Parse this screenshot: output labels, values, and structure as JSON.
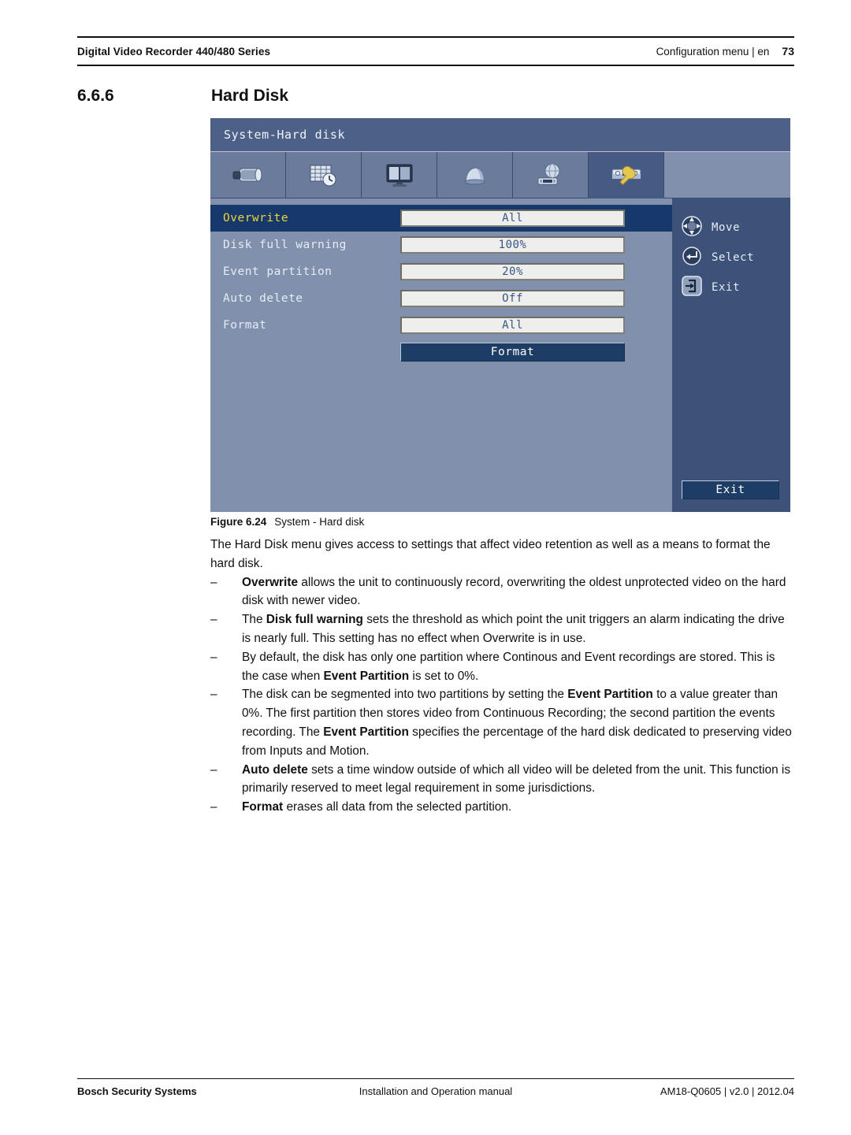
{
  "header": {
    "left_title": "Digital Video Recorder 440/480 Series",
    "right_title": "Configuration menu | en",
    "page_number": "73"
  },
  "section": {
    "number": "6.6.6",
    "title": "Hard Disk"
  },
  "screenshot": {
    "window_title": "System-Hard disk",
    "toolbar": {
      "tabs": [
        {
          "icon": "camera-icon",
          "name": "camera",
          "active": false
        },
        {
          "icon": "schedule-calendar-clock-icon",
          "name": "schedule",
          "active": false
        },
        {
          "icon": "display-monitor-icon",
          "name": "display",
          "active": false
        },
        {
          "icon": "alarm-siren-icon",
          "name": "event",
          "active": false
        },
        {
          "icon": "network-globe-icon",
          "name": "network",
          "active": false
        },
        {
          "icon": "wrench-system-icon",
          "name": "system",
          "active": true
        }
      ]
    },
    "settings": [
      {
        "label": "Overwrite",
        "value": "All",
        "selected": true
      },
      {
        "label": "Disk full warning",
        "value": "100%",
        "selected": false
      },
      {
        "label": "Event partition",
        "value": "20%",
        "selected": false
      },
      {
        "label": "Auto delete",
        "value": "Off",
        "selected": false
      },
      {
        "label": "Format",
        "value": "All",
        "selected": false
      }
    ],
    "format_button": "Format",
    "legend": [
      {
        "icon": "dpad-icon",
        "label": "Move"
      },
      {
        "icon": "enter-key-icon",
        "label": "Select"
      },
      {
        "icon": "exit-arrow-icon",
        "label": "Exit"
      }
    ],
    "exit_button": "Exit",
    "colors": {
      "panel_background": "#8190ac",
      "title_bar": "#4d6188",
      "selected_row": "#16386b",
      "selected_label_text": "#f2d43c",
      "value_field": "#eeeeec",
      "value_text": "#3a5384",
      "action_button": "#1d3d66",
      "sidebar": "#3d5279"
    }
  },
  "figure_caption": {
    "label": "Figure 6.24",
    "text": "System - Hard disk"
  },
  "body": {
    "intro": "The Hard Disk menu gives access to settings that affect video retention as well as a means to format the hard disk.",
    "bullet_marker": "–",
    "bullets": [
      [
        {
          "bold": true,
          "text": "Overwrite"
        },
        {
          "bold": false,
          "text": " allows the unit to continuously record, overwriting the oldest unprotected video on the hard disk with newer video."
        }
      ],
      [
        {
          "bold": false,
          "text": "The "
        },
        {
          "bold": true,
          "text": "Disk full warning"
        },
        {
          "bold": false,
          "text": " sets the threshold as which point the unit triggers an alarm indicating the drive is nearly full. This setting has no effect when Overwrite is in use."
        }
      ],
      [
        {
          "bold": false,
          "text": "By default, the disk has only one partition where Continous and Event recordings are stored. This is the case when "
        },
        {
          "bold": true,
          "text": "Event Partition"
        },
        {
          "bold": false,
          "text": " is set to 0%."
        }
      ],
      [
        {
          "bold": false,
          "text": "The disk can be segmented into two partitions by setting the "
        },
        {
          "bold": true,
          "text": "Event Partition"
        },
        {
          "bold": false,
          "text": " to a value greater than 0%. The first partition then stores video from Continuous Recording; the second partition the events recording. The "
        },
        {
          "bold": true,
          "text": "Event Partition"
        },
        {
          "bold": false,
          "text": " specifies the percentage of the hard disk dedicated to preserving video from Inputs and Motion."
        }
      ],
      [
        {
          "bold": true,
          "text": "Auto delete"
        },
        {
          "bold": false,
          "text": " sets a time window outside of which all video will be deleted from the unit. This function is primarily reserved to meet legal requirement in some jurisdictions."
        }
      ],
      [
        {
          "bold": true,
          "text": "Format"
        },
        {
          "bold": false,
          "text": " erases all data from the selected partition."
        }
      ]
    ]
  },
  "footer": {
    "left": "Bosch Security Systems",
    "center": "Installation and Operation manual",
    "right": "AM18-Q0605 | v2.0 | 2012.04"
  }
}
